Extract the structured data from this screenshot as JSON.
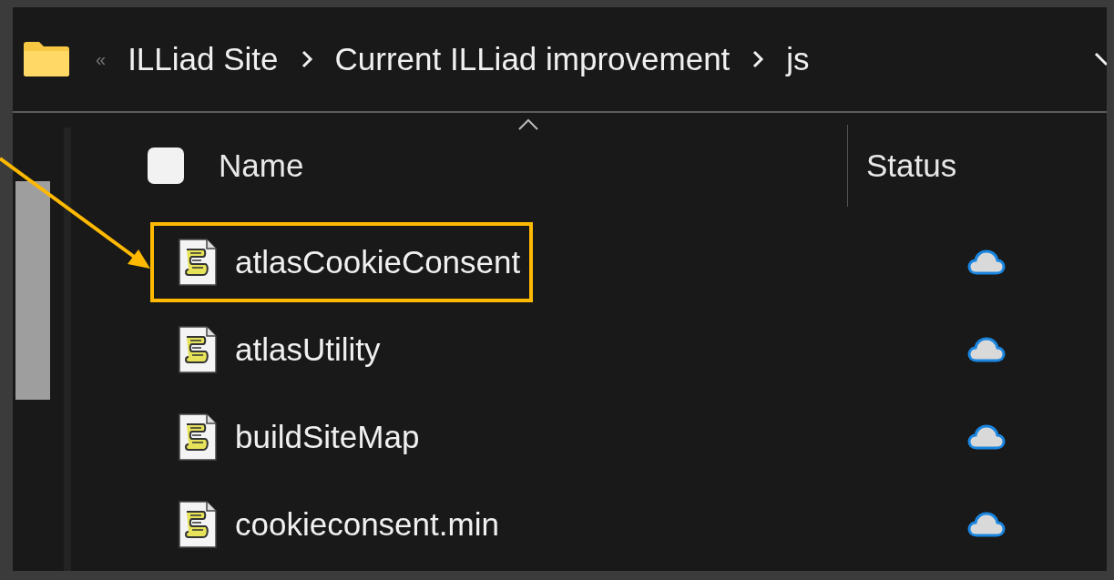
{
  "address_bar": {
    "overflow": "«",
    "breadcrumbs": [
      "ILLiad Site",
      "Current ILLiad improvement",
      "js"
    ]
  },
  "columns": [
    {
      "label": "Name",
      "sorted": true
    },
    {
      "label": "Status",
      "sorted": false
    }
  ],
  "select_all": {
    "checked": false
  },
  "files": [
    {
      "name": "atlasCookieConsent",
      "highlighted": true,
      "online_only": true
    },
    {
      "name": "atlasUtility",
      "highlighted": false,
      "online_only": true
    },
    {
      "name": "buildSiteMap",
      "highlighted": false,
      "online_only": true
    },
    {
      "name": "cookieconsent.min",
      "highlighted": false,
      "online_only": true
    }
  ]
}
